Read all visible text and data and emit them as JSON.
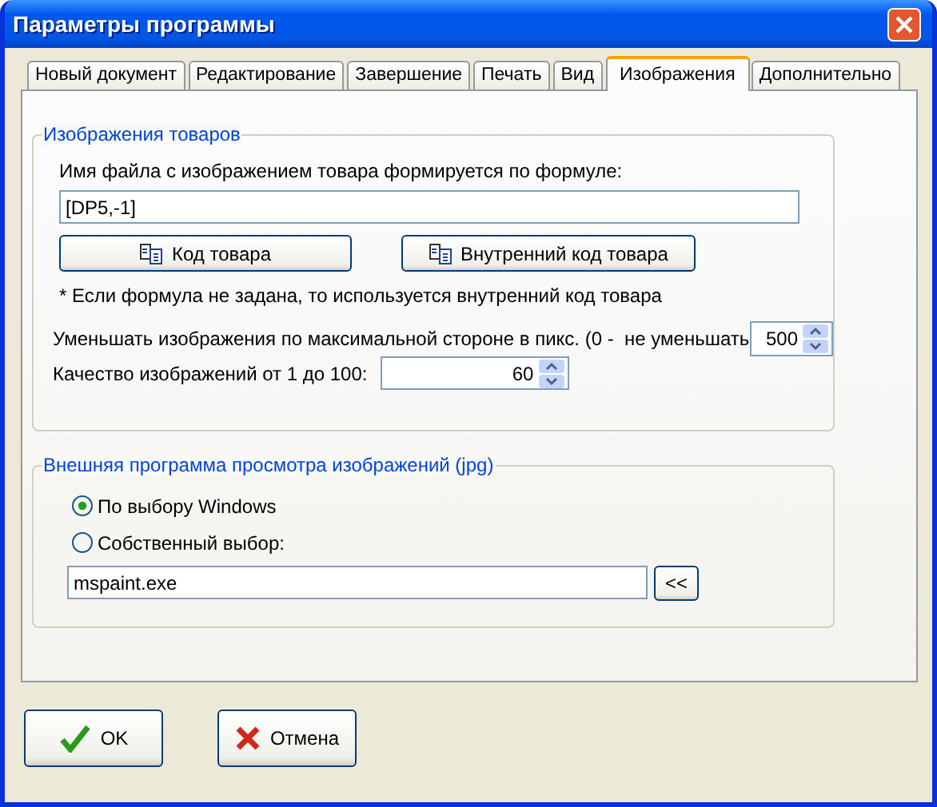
{
  "window": {
    "title": "Параметры программы"
  },
  "tabs": [
    {
      "label": "Новый документ",
      "selected": false
    },
    {
      "label": "Редактирование",
      "selected": false
    },
    {
      "label": "Завершение",
      "selected": false
    },
    {
      "label": "Печать",
      "selected": false
    },
    {
      "label": "Вид",
      "selected": false
    },
    {
      "label": "Изображения",
      "selected": true
    },
    {
      "label": "Дополнительно",
      "selected": false
    }
  ],
  "images_group": {
    "legend": "Изображения товаров",
    "formula_label": "Имя файла с изображением товара формируется по формуле:",
    "formula_value": "[DP5,-1]",
    "insert_buttons": [
      "Код товара",
      "Внутренний код товара"
    ],
    "note": "* Если формула не задана, то используется внутренний код товара",
    "reduce_label": "Уменьшать изображения по максимальной стороне в пикс. (0 -  не уменьшать",
    "reduce_value": "500",
    "quality_label": "Качество изображений от 1 до 100:",
    "quality_value": "60"
  },
  "viewer_group": {
    "legend": "Внешняя программа просмотра изображений (jpg)",
    "options": [
      {
        "label": "По выбору Windows",
        "selected": true
      },
      {
        "label": "Собственный выбор:",
        "selected": false
      }
    ],
    "path_value": "mspaint.exe",
    "browse_button": "<<"
  },
  "buttons": [
    {
      "label": "OK",
      "kind": "ok"
    },
    {
      "label": "Отмена",
      "kind": "cancel"
    }
  ]
}
